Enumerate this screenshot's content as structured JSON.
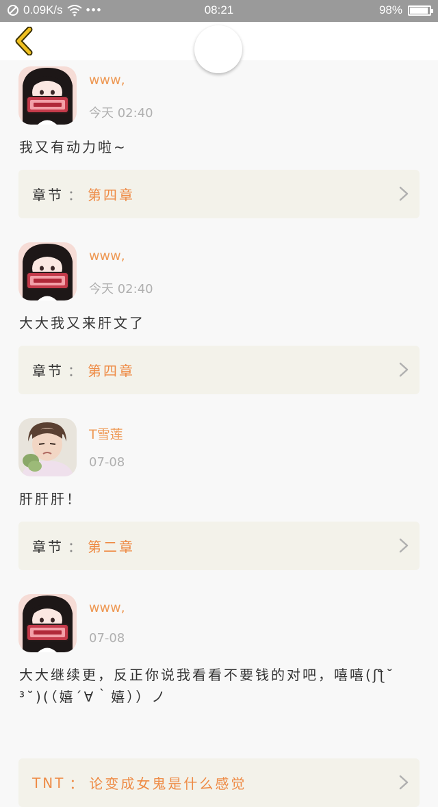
{
  "status_bar": {
    "network_speed": "0.09K/s",
    "more": "•••",
    "time": "08:21",
    "battery_percent": "98%",
    "battery_level": 0.98,
    "color": "#9a9a9a"
  },
  "nav": {
    "back_icon": "chevron-left-icon",
    "accent": "#f0c020"
  },
  "comments": [
    {
      "user": "www,",
      "time": "今天 02:40",
      "text": "我又有动力啦~",
      "chapter_prefix": "章节",
      "chapter_sep": "：",
      "chapter_name": "第四章"
    },
    {
      "user": "www,",
      "time": "今天 02:40",
      "text": "大大我又来肝文了",
      "chapter_prefix": "章节",
      "chapter_sep": "：",
      "chapter_name": "第四章"
    },
    {
      "user": "T雪莲",
      "time": "07-08",
      "text": "肝肝肝！",
      "chapter_prefix": "章节",
      "chapter_sep": "：",
      "chapter_name": "第二章"
    },
    {
      "user": "www,",
      "time": "07-08",
      "text": "大大继续更，反正你说我看看不要钱的对吧，嘻嘻(ʃƪ˘ ³˘)(（嬉´∀｀嬉））ノ",
      "chapter_prefix": "TNT",
      "chapter_sep": "：",
      "chapter_name": "论变成女鬼是什么感觉"
    }
  ],
  "colors": {
    "accent_orange": "#ee8a44",
    "chapter_bg": "#f3f2ea",
    "text": "#333333",
    "muted": "#b0b0b0"
  }
}
